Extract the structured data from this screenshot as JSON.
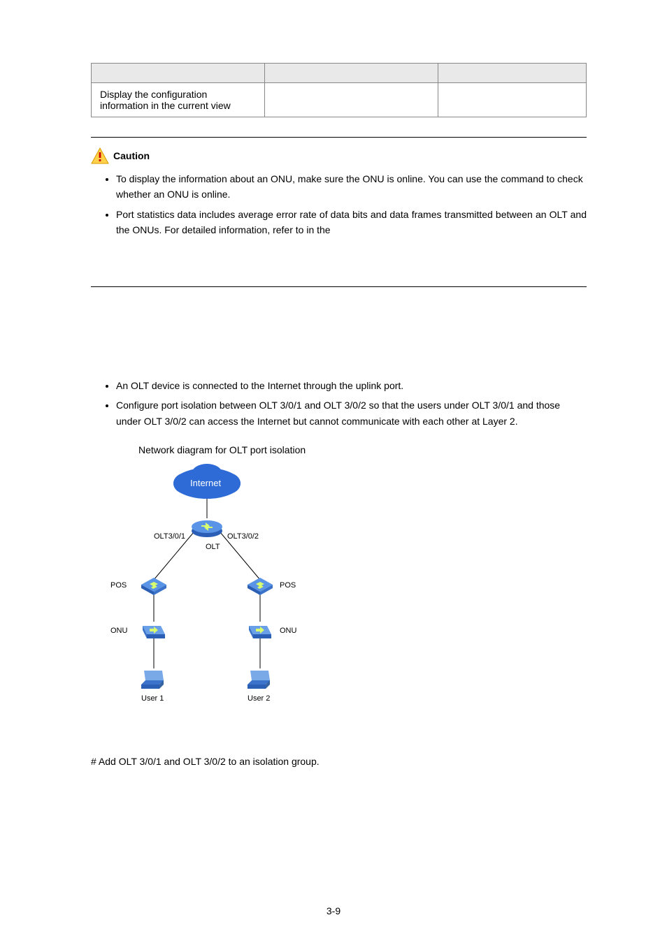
{
  "table": {
    "headers": [
      "",
      "",
      ""
    ],
    "row": {
      "c1": "Display the configuration information in the current view",
      "c2": "",
      "c3": ""
    }
  },
  "caution": {
    "title": "Caution",
    "items": [
      {
        "pre": "To display the information about an ONU, make sure the ONU is online. You can use the ",
        "post": " command to check whether an ONU is online."
      },
      {
        "pre": "Port statistics data includes average error rate of data bits and data frames transmitted between an OLT and the ONUs. For detailed information, refer to ",
        "post": " in the "
      }
    ]
  },
  "bullets": [
    "An OLT device is connected to the Internet through the uplink port.",
    "Configure port isolation between OLT 3/0/1 and OLT 3/0/2 so that the users under OLT 3/0/1 and those under OLT 3/0/2 can access the Internet but cannot communicate with each other at Layer 2."
  ],
  "figure": {
    "caption": "Network diagram for OLT port isolation",
    "labels": {
      "internet": "Internet",
      "olt_left": "OLT3/0/1",
      "olt_right": "OLT3/0/2",
      "olt": "OLT",
      "pos_left": "POS",
      "pos_right": "POS",
      "onu_left": "ONU",
      "onu_right": "ONU",
      "user1": "User 1",
      "user2": "User 2"
    }
  },
  "procedure_step": "# Add OLT 3/0/1 and OLT 3/0/2 to an isolation group.",
  "page_number": "3-9"
}
